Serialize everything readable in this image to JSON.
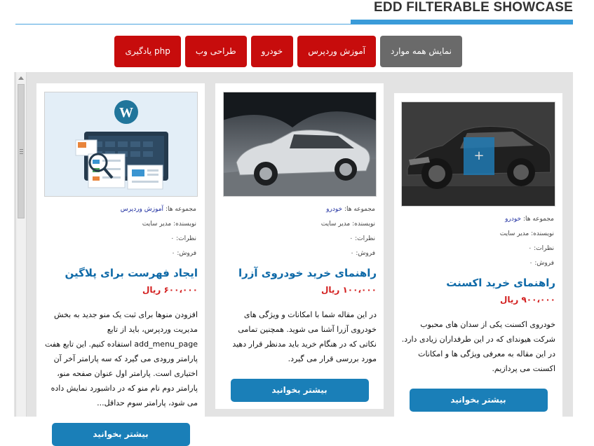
{
  "header": {
    "title": "EDD FILTERABLE SHOWCASE"
  },
  "filters": [
    {
      "label": "نمایش همه موارد",
      "active": true
    },
    {
      "label": "آموزش وردپرس",
      "active": false
    },
    {
      "label": "خودرو",
      "active": false
    },
    {
      "label": "طراحی وب",
      "active": false
    },
    {
      "label": "یادگیری php",
      "active": false
    }
  ],
  "meta_labels": {
    "collections": "مجموعه ها:",
    "author": "نویسنده: مدیر سایت",
    "comments": "نظرات: ۰",
    "sales": "فروش: ۰"
  },
  "cards": [
    {
      "category": "خودرو",
      "title": "راهنمای خرید اکسنت",
      "price": "۹۰۰،۰۰۰ ریال",
      "description": "خودروی اکسنت یکی از سدان های محبوب شرکت هیوندای که در این طرفداران زیادی دارد. در این مقاله به معرفی ویژگی ها و امکانات اکسنت می پردازیم.",
      "button": "بیشتر بخوانید",
      "overlay_icon": "+"
    },
    {
      "category": "خودرو",
      "title": "راهنمای خرید خودروی آزرا",
      "price": "۱۰۰،۰۰۰ ریال",
      "description": "در این مقاله شما با امکانات و ویژگی های خودروی آزرا آشنا می شوید. همچنین تمامی نکاتی که در هنگام خرید باید مدنظر قرار دهید مورد بررسی قرار می گیرد.",
      "button": "بیشتر بخوانید"
    },
    {
      "category": "آموزش وردپرس",
      "title": "ایجاد فهرست برای پلاگین",
      "price": "۶۰۰،۰۰۰ ریال",
      "description": "افزودن منوها برای ثبت یک منو جدید به بخش مدیریت وردپرس، باید از تابع add_menu_page استفاده کنیم. این تابع هفت پارامتر ورودی می گیرد که سه پارامتر آخر آن اختیاری است. پارامتر اول عنوان صفحه منو، پارامتر دوم نام منو که در داشبورد نمایش داده می شود، پارامتر سوم حداقل...",
      "button": "بیشتر بخوانید"
    }
  ]
}
